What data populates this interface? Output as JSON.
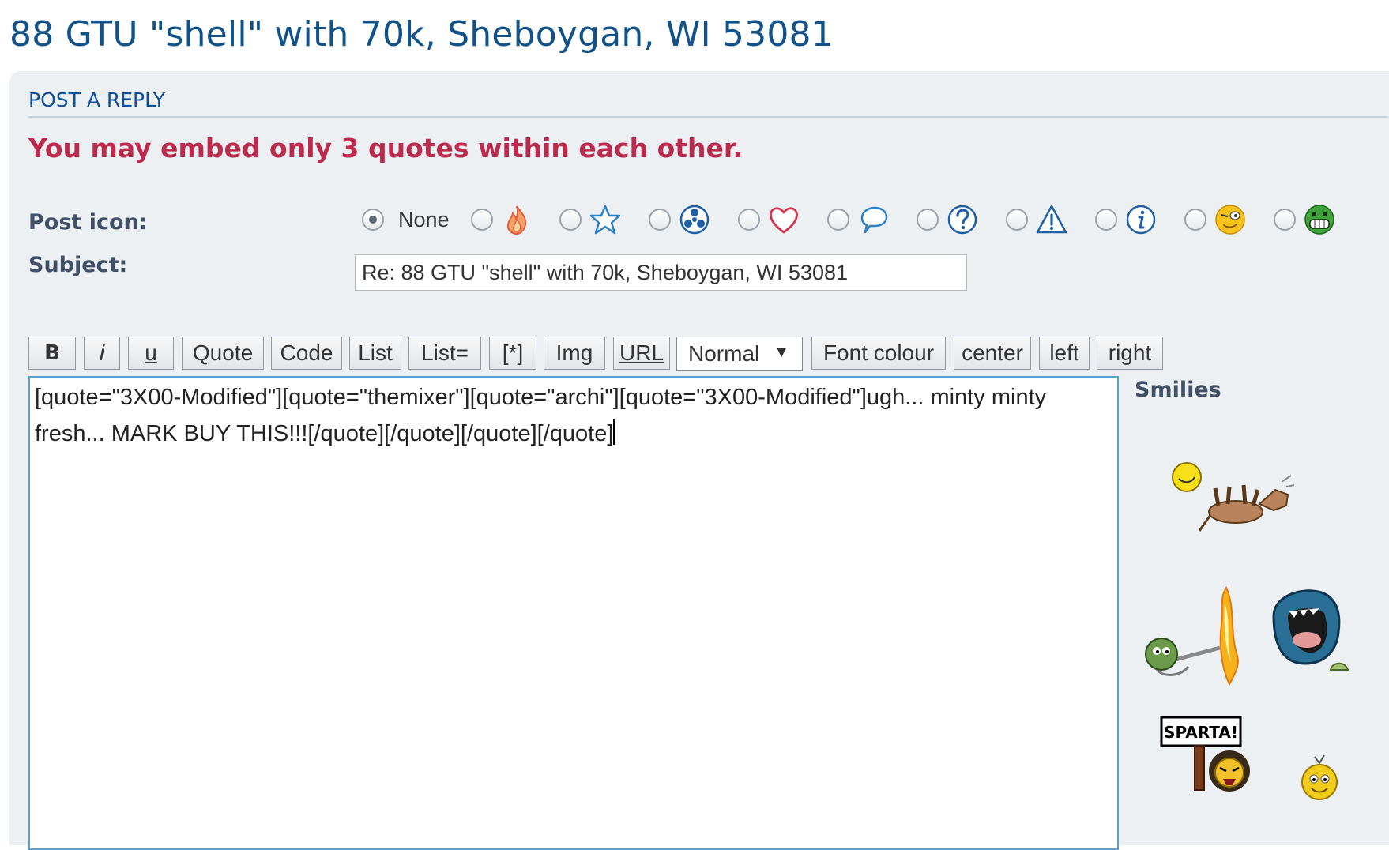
{
  "topic": {
    "title": "88 GTU \"shell\" with 70k, Sheboygan, WI 53081"
  },
  "panel": {
    "heading": "POST A REPLY",
    "error": "You may embed only 3 quotes within each other."
  },
  "post_icon": {
    "label": "Post icon:",
    "none_label": "None",
    "selected": "None",
    "icons": [
      "fire-icon",
      "star-icon",
      "radioactive-icon",
      "heart-icon",
      "speech-bubble-icon",
      "question-icon",
      "warning-icon",
      "info-icon",
      "wink-face-icon",
      "grin-face-icon"
    ]
  },
  "subject": {
    "label": "Subject:",
    "value": "Re: 88 GTU \"shell\" with 70k, Sheboygan, WI 53081"
  },
  "toolbar": {
    "bold": "B",
    "italic": "i",
    "underline": "u",
    "quote": "Quote",
    "code": "Code",
    "list": "List",
    "list_eq": "List=",
    "list_item": "[*]",
    "img": "Img",
    "url": "URL",
    "font_size": "Normal",
    "font_colour": "Font colour",
    "center": "center",
    "left": "left",
    "right": "right"
  },
  "editor": {
    "text": "[quote=\"3X00-Modified\"][quote=\"themixer\"][quote=\"archi\"][quote=\"3X00-Modified\"]ugh... minty minty fresh... MARK BUY THIS!!![/quote][/quote][/quote][/quote]"
  },
  "smilies": {
    "title": "Smilies",
    "items": [
      "horse-smiley-icon",
      "flamethrower-smiley-icon",
      "screaming-monster-smiley-icon",
      "sparta-smiley-icon",
      "small-smiley-icon"
    ],
    "sign_text": "SPARTA!"
  },
  "colors": {
    "title": "#105289",
    "heading": "#115098",
    "error": "#bc2a4d",
    "panel_bg": "#ecf0f3",
    "label": "#425067",
    "editor_border": "#5ba0d0"
  }
}
